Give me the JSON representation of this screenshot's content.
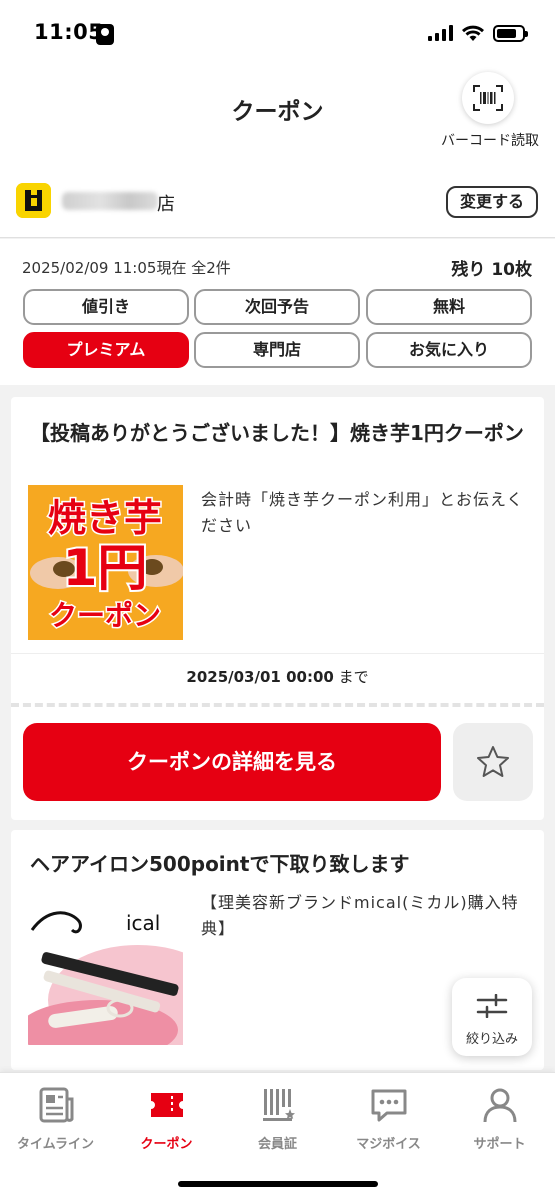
{
  "status_bar": {
    "time": "11:05"
  },
  "header": {
    "title": "クーポン",
    "barcode_label": "バーコード読取"
  },
  "store": {
    "suffix": "店",
    "change_label": "変更する",
    "logo_icon": "dotmoney-d-logo"
  },
  "filter": {
    "meta": "2025/02/09 11:05現在 全2件",
    "remaining": "残り 10枚",
    "chips": [
      {
        "label": "値引き",
        "active": false
      },
      {
        "label": "次回予告",
        "active": false
      },
      {
        "label": "無料",
        "active": false
      },
      {
        "label": "プレミアム",
        "active": true
      },
      {
        "label": "専門店",
        "active": false
      },
      {
        "label": "お気に入り",
        "active": false
      }
    ]
  },
  "coupons": [
    {
      "title": "【投稿ありがとうございました！】焼き芋1円クーポン",
      "description": "会計時「焼き芋クーポン利用」とお伝えください",
      "image_text": {
        "line1": "焼き芋",
        "line2": "1円",
        "line3": "クーポン"
      },
      "expiry_date": "2025/03/01 00:00",
      "expiry_suffix": "まで",
      "detail_label": "クーポンの詳細を見る"
    },
    {
      "title": "ヘアアイロン500pointで下取り致します",
      "description": "【理美容新ブランドmical(ミカル)購入特典】",
      "image_text": {
        "brand": "ical"
      }
    }
  ],
  "filter_fab": {
    "label": "絞り込み"
  },
  "bottom_nav": [
    {
      "label": "タイムライン",
      "icon": "news-icon",
      "active": false
    },
    {
      "label": "クーポン",
      "icon": "ticket-icon",
      "active": true
    },
    {
      "label": "会員証",
      "icon": "member-card-icon",
      "active": false
    },
    {
      "label": "マジボイス",
      "icon": "speech-bubble-icon",
      "active": false
    },
    {
      "label": "サポート",
      "icon": "person-icon",
      "active": false
    }
  ],
  "colors": {
    "accent": "#e60012",
    "logo": "#f9d400"
  }
}
